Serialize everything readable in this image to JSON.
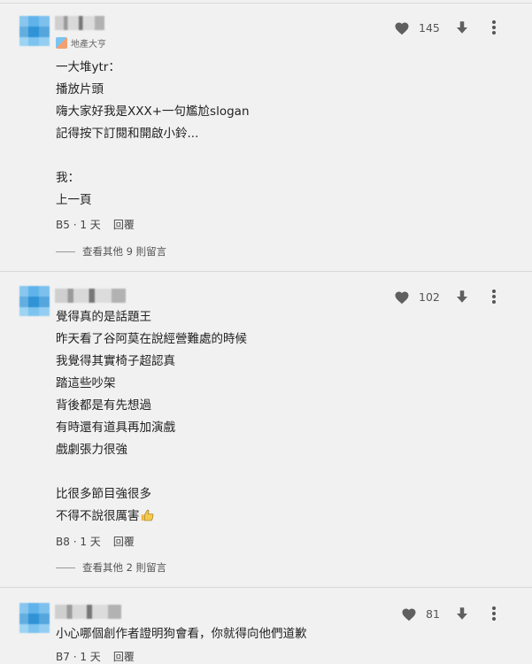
{
  "comments": [
    {
      "badge_text": "地產大亨",
      "lines": "一大堆ytr：\n播放片頭\n嗨大家好我是XXX+一句尷尬slogan\n記得按下訂閱和開啟小鈴...\n\n我：\n上一頁",
      "meta_id": "B5",
      "meta_time": "1 天",
      "reply_label": "回覆",
      "like_count": "145",
      "view_replies": "查看其他 9 則留言"
    },
    {
      "lines": "覺得真的是話題王\n昨天看了谷阿莫在說經營難處的時候\n我覺得其實椅子超認真\n踏這些吵架\n背後都是有先想過\n有時還有道具再加演戲\n戲劇張力很強\n\n比很多節目強很多\n不得不說很厲害",
      "meta_id": "B8",
      "meta_time": "1 天",
      "reply_label": "回覆",
      "like_count": "102",
      "view_replies": "查看其他 2 則留言"
    },
    {
      "lines": "小心哪個創作者證明狗會看，你就得向他們道歉",
      "meta_id": "B7",
      "meta_time": "1 天",
      "reply_label": "回覆",
      "like_count": "81"
    }
  ],
  "meta_separator": "·",
  "icons": {
    "like": "heart-icon",
    "dislike": "arrow-down-icon",
    "more": "more-vertical-icon",
    "emoji": "thumbs-up-emoji"
  }
}
